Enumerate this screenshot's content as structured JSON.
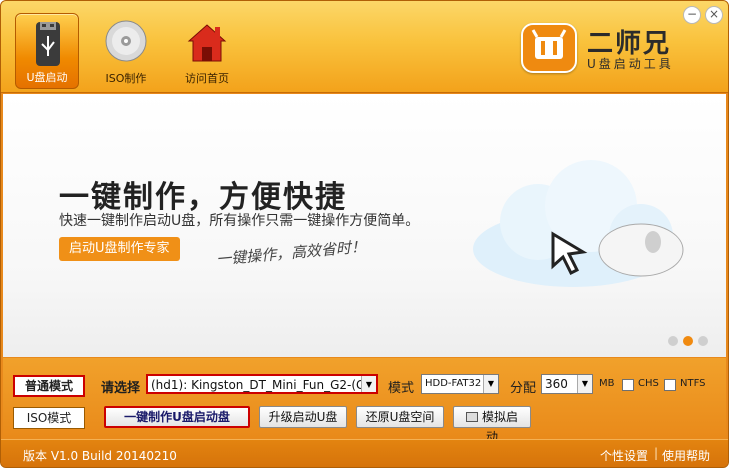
{
  "nav": {
    "items": [
      {
        "label": "U盘启动",
        "icon": "usb-drive-icon"
      },
      {
        "label": "ISO制作",
        "icon": "cd-disc-icon"
      },
      {
        "label": "访问首页",
        "icon": "home-icon"
      }
    ]
  },
  "brand": {
    "name": "二师兄",
    "subtitle": "U盘启动工具",
    "icon": "brand-logo-icon"
  },
  "window_controls": {
    "minimize": "−",
    "close": "×"
  },
  "banner": {
    "headline": "一键制作，方便快捷",
    "subline": "快速一键制作启动U盘，所有操作只需一键操作方便简单。",
    "tag": "启动U盘制作专家",
    "slogan": "一键操作，高效省时！",
    "slide_count": 3,
    "active_slide": 2
  },
  "controls": {
    "mode_normal": "普通模式",
    "mode_iso": "ISO模式",
    "select_label": "请选择",
    "device_value": "(hd1): Kingston_DT_Mini_Fun_G2-(G:",
    "mode_label": "模式",
    "mode_value": "HDD-FAT32",
    "partition_label": "分配",
    "partition_value": "360",
    "unit": "MB",
    "chs_label": "CHS",
    "ntfs_label": "NTFS",
    "btn_make": "一键制作U盘启动盘",
    "btn_upgrade": "升级启动U盘",
    "btn_restore": "还原U盘空间",
    "btn_simulate": "模拟启动"
  },
  "status": {
    "version": "版本 V1.0 Build 20140210",
    "settings": "个性设置",
    "separator": "|",
    "help": "使用帮助"
  },
  "colors": {
    "accent": "#f08a10",
    "highlight_border": "#cc0000"
  }
}
